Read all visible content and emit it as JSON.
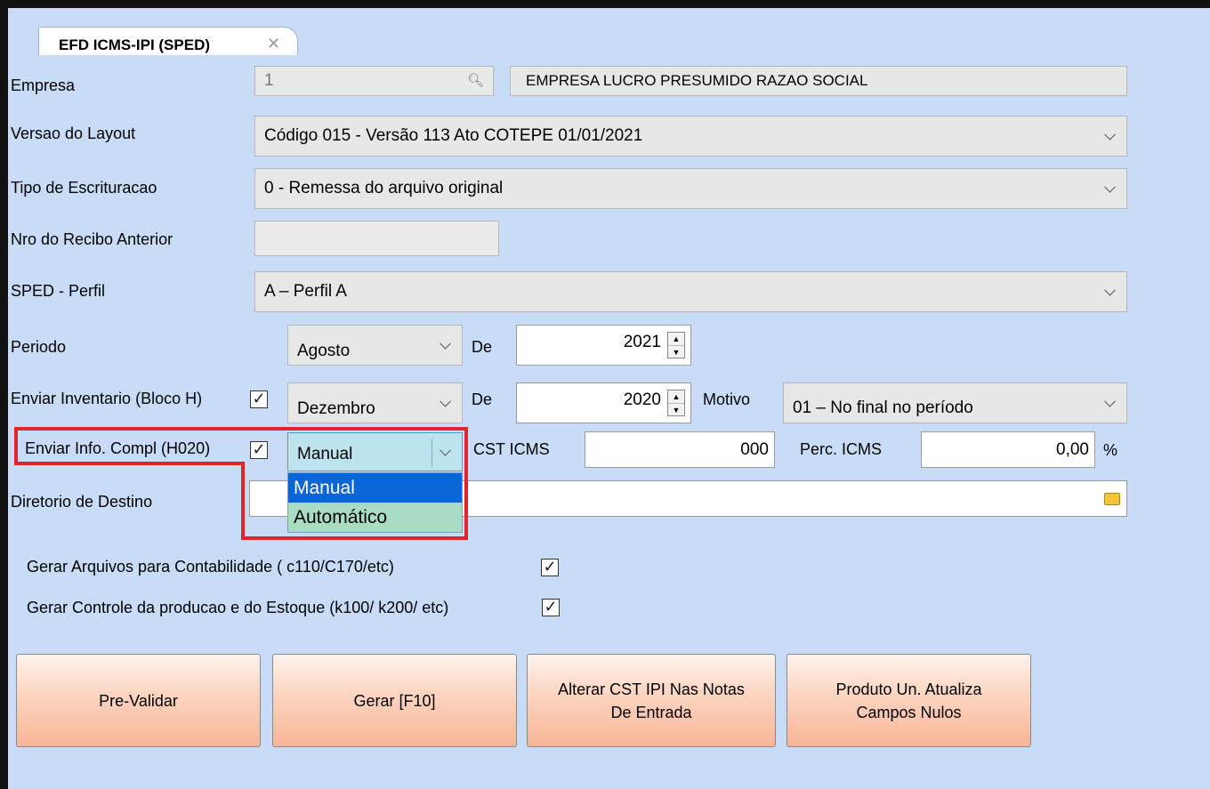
{
  "tab": {
    "title": "EFD ICMS-IPI (SPED)",
    "close_glyph": "✕"
  },
  "empresa": {
    "label": "Empresa",
    "code": "1",
    "name": "EMPRESA LUCRO PRESUMIDO RAZAO SOCIAL"
  },
  "versao": {
    "label": "Versao do Layout",
    "value": "Código 015 - Versão 113 Ato COTEPE 01/01/2021"
  },
  "tipo": {
    "label": "Tipo de Escrituracao",
    "value": "0 - Remessa do arquivo original"
  },
  "recibo": {
    "label": "Nro do Recibo Anterior",
    "value": ""
  },
  "perfil": {
    "label": "SPED - Perfil",
    "value": "A – Perfil A"
  },
  "periodo": {
    "label": "Periodo",
    "month": "Agosto",
    "de_label": "De",
    "year": "2021"
  },
  "inventario": {
    "label": "Enviar Inventario (Bloco H)",
    "checked": true,
    "month": "Dezembro",
    "de_label": "De",
    "year": "2020",
    "motivo_label": "Motivo",
    "motivo_value": "01 – No final no período"
  },
  "info_compl": {
    "label": "Enviar Info. Compl (H020)",
    "checked": true,
    "selected": "Manual",
    "options": [
      "Manual",
      "Automático"
    ],
    "cst_label": "CST ICMS",
    "cst_value": "000",
    "perc_label": "Perc. ICMS",
    "perc_value": "0,00",
    "perc_unit": "%"
  },
  "diretorio": {
    "label": "Diretorio de Destino",
    "value": ""
  },
  "checks": {
    "contabilidade": {
      "label": "Gerar Arquivos para Contabilidade ( c110/C170/etc)",
      "checked": true
    },
    "producao": {
      "label": "Gerar Controle da producao e do Estoque (k100/ k200/ etc)",
      "checked": true
    }
  },
  "buttons": {
    "pre_validar": "Pre-Validar",
    "gerar": "Gerar [F10]",
    "alterar_cst_1": "Alterar CST IPI Nas Notas",
    "alterar_cst_2": "De Entrada",
    "produto_1": "Produto Un. Atualiza",
    "produto_2": "Campos Nulos"
  },
  "icons": {
    "search": "search-icon",
    "folder": "folder-icon",
    "check": "✓",
    "spin_up": "▲",
    "spin_down": "▼"
  },
  "colors": {
    "background": "#c9dcf7",
    "button": "#f8b597",
    "highlight_border": "#e4232c",
    "selected_option": "#0a66d6",
    "hover_option": "#a8dcc5"
  }
}
